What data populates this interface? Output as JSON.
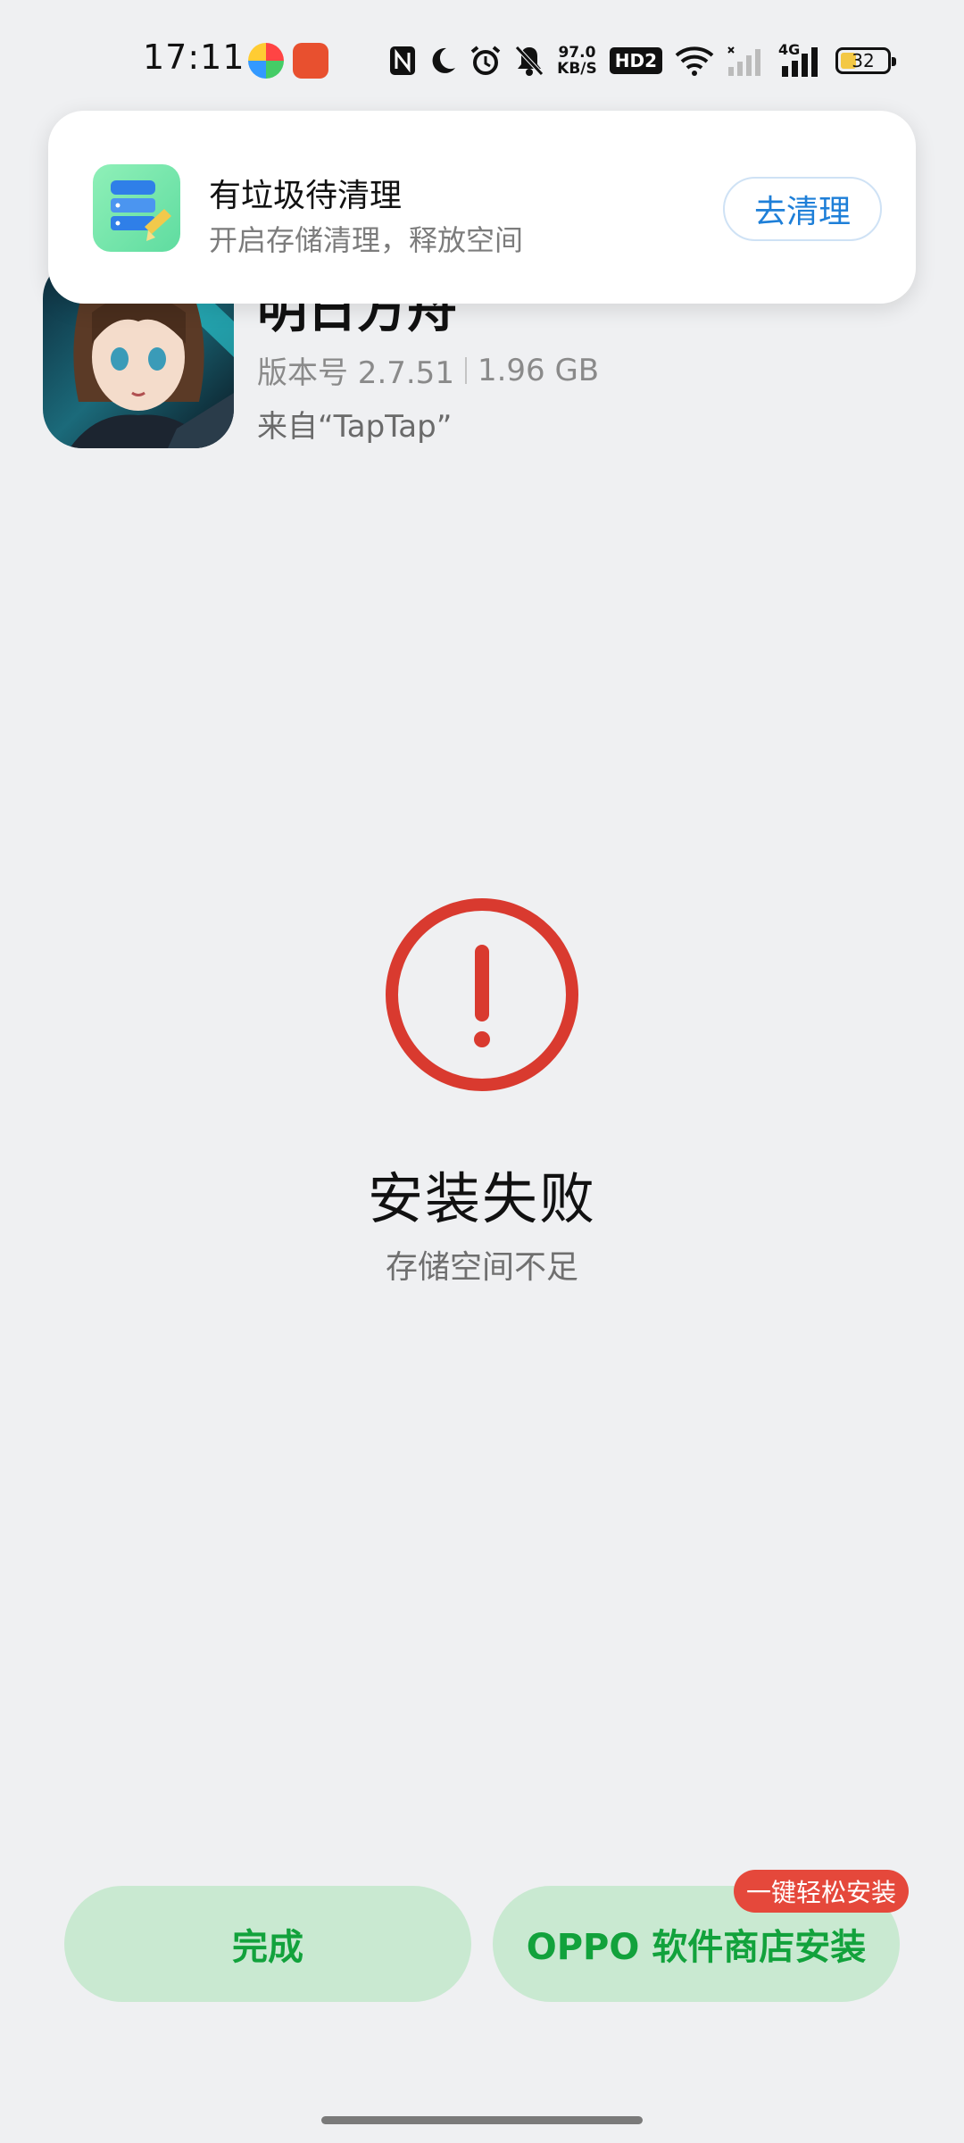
{
  "status_bar": {
    "time": "17:11",
    "net_speed_value": "97.0",
    "net_speed_unit": "KB/S",
    "hd_label": "HD2",
    "network_type": "4G",
    "battery_level": "32",
    "icons": [
      "app-notification-icon",
      "app-notification-icon-2",
      "nfc-icon",
      "moon-icon",
      "alarm-icon",
      "mute-icon",
      "wifi-icon",
      "signal-icon",
      "signal-icon-2",
      "battery-icon"
    ]
  },
  "notification": {
    "title": "有垃圾待清理",
    "subtitle": "开启存储清理，释放空间",
    "button_label": "去清理",
    "icon": "storage-cleaner-icon"
  },
  "app": {
    "name": "明日方舟",
    "version": "版本号 2.7.51",
    "size": "1.96 GB",
    "source": "来自“TapTap”",
    "icon": "app-icon"
  },
  "result": {
    "icon": "error-icon",
    "title": "安装失败",
    "message": "存储空间不足"
  },
  "actions": {
    "done_label": "完成",
    "store_label": "OPPO 软件商店安装",
    "store_badge": "一键轻松安装"
  },
  "colors": {
    "background": "#eff0f2",
    "error_red": "#d93a2f",
    "button_green_bg": "#c9e9d1",
    "button_green_text": "#12a23c",
    "link_blue": "#1e7fd8",
    "badge_red": "#e5483b"
  }
}
